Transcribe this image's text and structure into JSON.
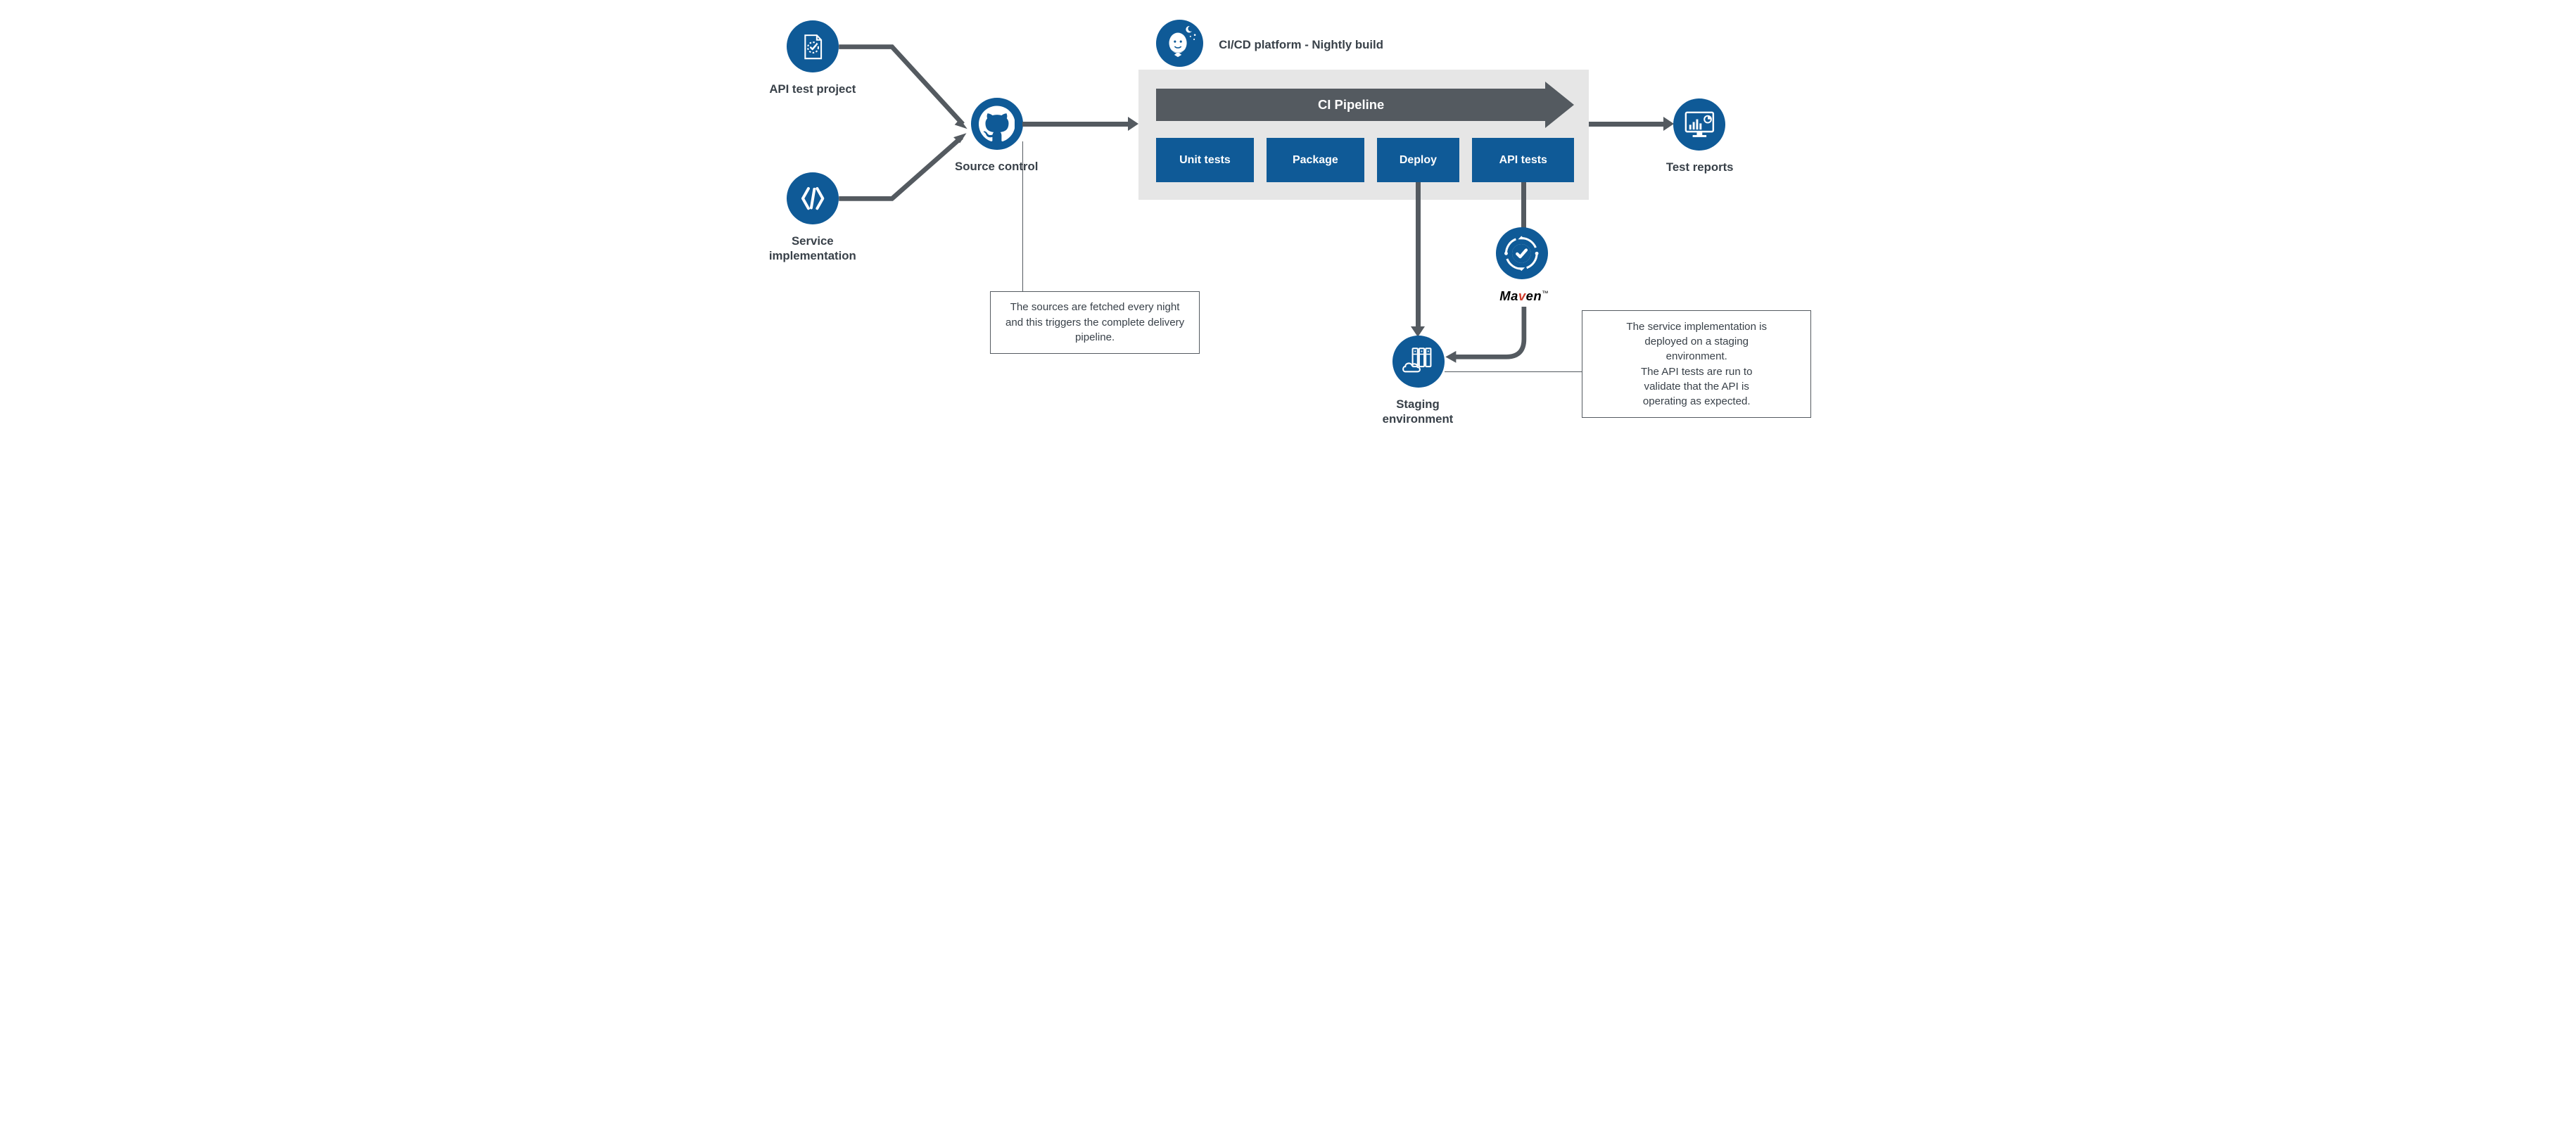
{
  "nodes": {
    "api_test_project": "API test project",
    "service_impl_line1": "Service",
    "service_impl_line2": "implementation",
    "source_control": "Source control",
    "cicd_title": "CI/CD platform - Nightly build",
    "pipeline_banner": "CI Pipeline",
    "stage1": "Unit tests",
    "stage2": "Package",
    "stage3": "Deploy",
    "stage4": "API tests",
    "test_reports": "Test reports",
    "staging_line1": "Staging",
    "staging_line2": "environment",
    "maven_prefix": "Ma",
    "maven_v": "v",
    "maven_suffix": "en",
    "maven_tm": "™"
  },
  "notes": {
    "source_note": "The sources are fetched every night and this triggers the complete delivery pipeline.",
    "staging_note_l1": "The service implementation is",
    "staging_note_l2": "deployed on a staging",
    "staging_note_l3": "environment.",
    "staging_note_l4": "The API tests are run to",
    "staging_note_l5": "validate that the API is",
    "staging_note_l6": "operating as expected."
  }
}
